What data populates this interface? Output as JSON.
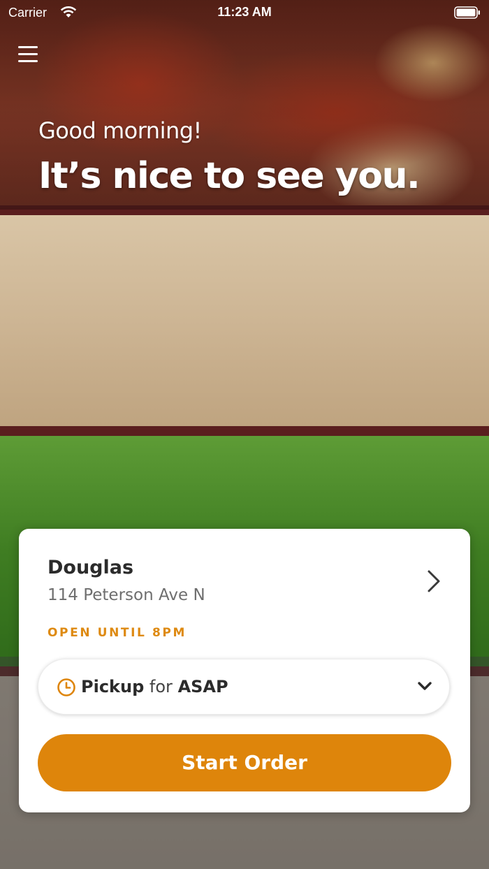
{
  "status_bar": {
    "carrier": "Carrier",
    "time": "11:23 AM",
    "wifi_icon": "wifi-icon",
    "battery_icon": "battery-icon"
  },
  "header": {
    "menu_icon": "hamburger-menu-icon",
    "greeting": "Good morning!",
    "headline": "It’s nice to see you."
  },
  "background": {
    "images": [
      "pizza-photo",
      "sandwich-photo",
      "salad-photo",
      "soup-photo"
    ]
  },
  "store": {
    "name": "Douglas",
    "address": "114 Peterson Ave N",
    "hours": "OPEN UNTIL 8PM"
  },
  "order_mode": {
    "mode": "Pickup",
    "connector": "for",
    "time": "ASAP",
    "icon": "clock-icon"
  },
  "actions": {
    "start_order": "Start Order"
  },
  "colors": {
    "accent": "#de850b",
    "hours_text": "#de8a12",
    "divider": "#5a1e1e"
  }
}
